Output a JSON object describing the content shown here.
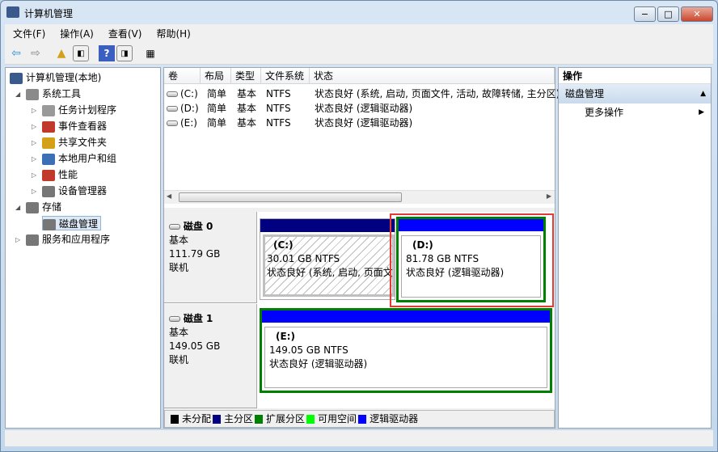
{
  "window": {
    "title": "计算机管理",
    "minimize": "−",
    "maximize": "□",
    "close": "✕"
  },
  "menu": [
    "文件(F)",
    "操作(A)",
    "查看(V)",
    "帮助(H)"
  ],
  "toolbar": [
    "back-icon",
    "forward-icon",
    "up-icon",
    "show-hide-tree-icon",
    "help-icon",
    "show-hide-action-icon",
    "properties-icon"
  ],
  "tree": {
    "items": [
      {
        "label": "计算机管理(本地)",
        "level": 0,
        "icon_color": "#3a5a8c"
      },
      {
        "label": "系统工具",
        "level": 1,
        "expanded": true,
        "icon_color": "#8a8a8a"
      },
      {
        "label": "任务计划程序",
        "level": 2,
        "icon_color": "#999"
      },
      {
        "label": "事件查看器",
        "level": 2,
        "icon_color": "#c0392b"
      },
      {
        "label": "共享文件夹",
        "level": 2,
        "icon_color": "#d4a017"
      },
      {
        "label": "本地用户和组",
        "level": 2,
        "icon_color": "#3b6fb6"
      },
      {
        "label": "性能",
        "level": 2,
        "icon_color": "#c0392b"
      },
      {
        "label": "设备管理器",
        "level": 2,
        "icon_color": "#777"
      },
      {
        "label": "存储",
        "level": 1,
        "expanded": true,
        "icon_color": "#777"
      },
      {
        "label": "磁盘管理",
        "level": 2,
        "selected": true,
        "icon_color": "#777"
      },
      {
        "label": "服务和应用程序",
        "level": 1,
        "icon_color": "#777"
      }
    ]
  },
  "volumes": {
    "headers": [
      "卷",
      "布局",
      "类型",
      "文件系统",
      "状态"
    ],
    "rows": [
      [
        "(C:)",
        "简单",
        "基本",
        "NTFS",
        "状态良好 (系统, 启动, 页面文件, 活动, 故障转储, 主分区)"
      ],
      [
        "(D:)",
        "简单",
        "基本",
        "NTFS",
        "状态良好 (逻辑驱动器)"
      ],
      [
        "(E:)",
        "简单",
        "基本",
        "NTFS",
        "状态良好 (逻辑驱动器)"
      ]
    ]
  },
  "disks": [
    {
      "name": "磁盘 0",
      "type": "基本",
      "size": "111.79 GB",
      "state": "联机",
      "partitions": [
        {
          "letter": "(C:)",
          "size": "30.01 GB NTFS",
          "status": "状态良好 (系统, 启动, 页面文件, 活动, 故障转储, 主分区)"
        },
        {
          "letter": "(D:)",
          "size": "81.78 GB NTFS",
          "status": "状态良好 (逻辑驱动器)"
        }
      ]
    },
    {
      "name": "磁盘 1",
      "type": "基本",
      "size": "149.05 GB",
      "state": "联机",
      "partitions": [
        {
          "letter": "(E:)",
          "size": "149.05 GB NTFS",
          "status": "状态良好 (逻辑驱动器)"
        }
      ]
    }
  ],
  "legend": [
    {
      "label": "未分配",
      "color": "#000000"
    },
    {
      "label": "主分区",
      "color": "#000080"
    },
    {
      "label": "扩展分区",
      "color": "#008000"
    },
    {
      "label": "可用空间",
      "color": "#00ff00"
    },
    {
      "label": "逻辑驱动器",
      "color": "#0000ff"
    }
  ],
  "actions": {
    "title": "操作",
    "section": "磁盘管理",
    "more": "更多操作"
  },
  "highlight_color": "#e53935"
}
